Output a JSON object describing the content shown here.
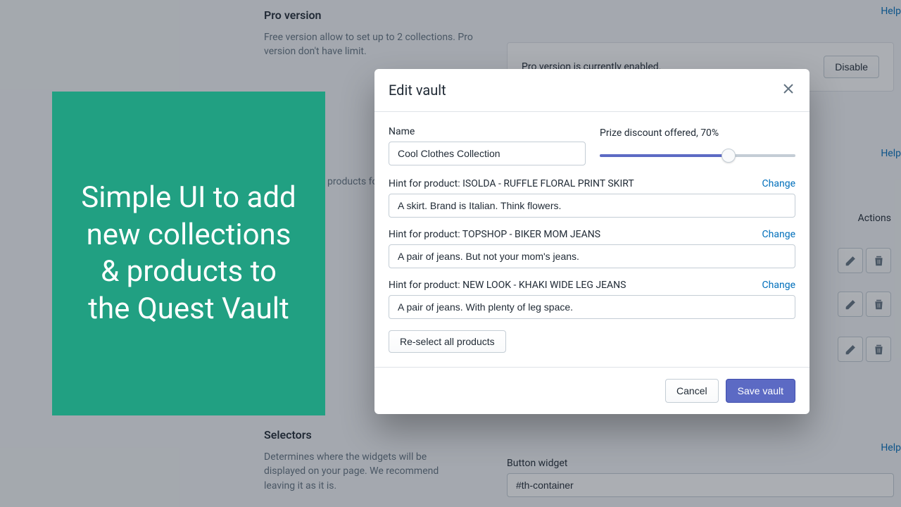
{
  "background": {
    "pro_section": {
      "title": "Pro version",
      "desc": "Free version allow to set up to 2 collections. Pro version don't have limit.",
      "status_msg": "Pro version is currently enabled.",
      "disable_btn": "Disable"
    },
    "help_link": "Help",
    "row_desc_fragment": "products fo",
    "actions_header": "Actions",
    "selectors": {
      "title": "Selectors",
      "desc": "Determines where the widgets will be displayed on your page. We recommend leaving it as it is.",
      "button_widget_label": "Button widget",
      "button_widget_value": "#th-container"
    }
  },
  "callout": {
    "text": "Simple UI to add new collections & products to the Quest Vault"
  },
  "modal": {
    "title": "Edit vault",
    "name_label": "Name",
    "name_value": "Cool Clothes Collection",
    "discount_label": "Prize discount offered, 70%",
    "discount_percent": 70,
    "hints": [
      {
        "label": "Hint for product: ISOLDA - RUFFLE FLORAL PRINT SKIRT",
        "value": "A skirt. Brand is Italian. Think flowers.",
        "change": "Change"
      },
      {
        "label": "Hint for product: TOPSHOP - BIKER MOM JEANS",
        "value": "A pair of jeans. But not your mom's jeans.",
        "change": "Change"
      },
      {
        "label": "Hint for product: NEW LOOK - KHAKI WIDE LEG JEANS",
        "value": "A pair of jeans. With plenty of leg space.",
        "change": "Change"
      }
    ],
    "reselect_btn": "Re-select all products",
    "cancel_btn": "Cancel",
    "save_btn": "Save vault"
  }
}
